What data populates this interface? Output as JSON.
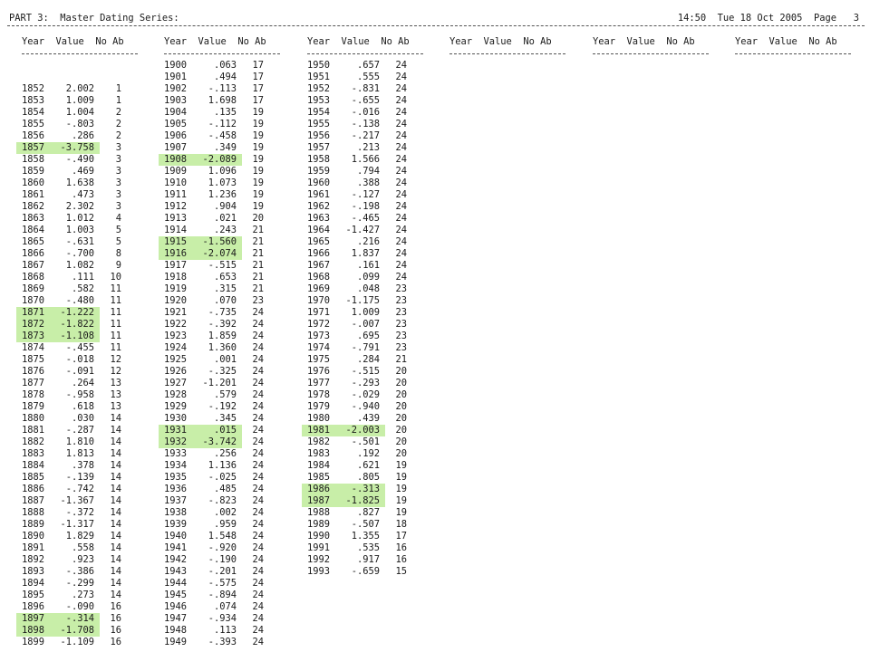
{
  "header": {
    "left": "PART 3:  Master Dating Series:",
    "right": "14:50  Tue 18 Oct 2005  Page   3"
  },
  "column_headers": {
    "year": "Year",
    "value": "Value",
    "noab": "No Ab"
  },
  "columns": [
    {
      "rows": [
        {
          "y": "",
          "v": "",
          "n": ""
        },
        {
          "y": "",
          "v": "",
          "n": ""
        },
        {
          "y": "1852",
          "v": "2.002",
          "n": "1"
        },
        {
          "y": "1853",
          "v": "1.009",
          "n": "1"
        },
        {
          "y": "1854",
          "v": "1.004",
          "n": "2"
        },
        {
          "y": "1855",
          "v": "-.803",
          "n": "2"
        },
        {
          "y": "1856",
          "v": ".286",
          "n": "2"
        },
        {
          "y": "1857",
          "v": "-3.758",
          "n": "3",
          "hl": true
        },
        {
          "y": "1858",
          "v": "-.490",
          "n": "3"
        },
        {
          "y": "1859",
          "v": ".469",
          "n": "3"
        },
        {
          "y": "1860",
          "v": "1.638",
          "n": "3"
        },
        {
          "y": "1861",
          "v": ".473",
          "n": "3"
        },
        {
          "y": "1862",
          "v": "2.302",
          "n": "3"
        },
        {
          "y": "1863",
          "v": "1.012",
          "n": "4"
        },
        {
          "y": "1864",
          "v": "1.003",
          "n": "5"
        },
        {
          "y": "1865",
          "v": "-.631",
          "n": "5"
        },
        {
          "y": "1866",
          "v": "-.700",
          "n": "8"
        },
        {
          "y": "1867",
          "v": "1.082",
          "n": "9"
        },
        {
          "y": "1868",
          "v": ".111",
          "n": "10"
        },
        {
          "y": "1869",
          "v": ".582",
          "n": "11"
        },
        {
          "y": "1870",
          "v": "-.480",
          "n": "11"
        },
        {
          "y": "1871",
          "v": "-1.222",
          "n": "11",
          "hl": true
        },
        {
          "y": "1872",
          "v": "-1.822",
          "n": "11",
          "hl": true
        },
        {
          "y": "1873",
          "v": "-1.108",
          "n": "11",
          "hl": true
        },
        {
          "y": "1874",
          "v": "-.455",
          "n": "11"
        },
        {
          "y": "1875",
          "v": "-.018",
          "n": "12"
        },
        {
          "y": "1876",
          "v": "-.091",
          "n": "12"
        },
        {
          "y": "1877",
          "v": ".264",
          "n": "13"
        },
        {
          "y": "1878",
          "v": "-.958",
          "n": "13"
        },
        {
          "y": "1879",
          "v": ".618",
          "n": "13"
        },
        {
          "y": "1880",
          "v": ".030",
          "n": "14"
        },
        {
          "y": "1881",
          "v": "-.287",
          "n": "14"
        },
        {
          "y": "1882",
          "v": "1.810",
          "n": "14"
        },
        {
          "y": "1883",
          "v": "1.813",
          "n": "14"
        },
        {
          "y": "1884",
          "v": ".378",
          "n": "14"
        },
        {
          "y": "1885",
          "v": "-.139",
          "n": "14"
        },
        {
          "y": "1886",
          "v": "-.742",
          "n": "14"
        },
        {
          "y": "1887",
          "v": "-1.367",
          "n": "14"
        },
        {
          "y": "1888",
          "v": "-.372",
          "n": "14"
        },
        {
          "y": "1889",
          "v": "-1.317",
          "n": "14"
        },
        {
          "y": "1890",
          "v": "1.829",
          "n": "14"
        },
        {
          "y": "1891",
          "v": ".558",
          "n": "14"
        },
        {
          "y": "1892",
          "v": ".923",
          "n": "14"
        },
        {
          "y": "1893",
          "v": "-.386",
          "n": "14"
        },
        {
          "y": "1894",
          "v": "-.299",
          "n": "14"
        },
        {
          "y": "1895",
          "v": ".273",
          "n": "14"
        },
        {
          "y": "1896",
          "v": "-.090",
          "n": "16"
        },
        {
          "y": "1897",
          "v": "-.314",
          "n": "16",
          "hl": true
        },
        {
          "y": "1898",
          "v": "-1.708",
          "n": "16",
          "hl": true
        },
        {
          "y": "1899",
          "v": "-1.109",
          "n": "16"
        }
      ]
    },
    {
      "rows": [
        {
          "y": "1900",
          "v": ".063",
          "n": "17"
        },
        {
          "y": "1901",
          "v": ".494",
          "n": "17"
        },
        {
          "y": "1902",
          "v": "-.113",
          "n": "17"
        },
        {
          "y": "1903",
          "v": "1.698",
          "n": "17"
        },
        {
          "y": "1904",
          "v": ".135",
          "n": "19"
        },
        {
          "y": "1905",
          "v": "-.112",
          "n": "19"
        },
        {
          "y": "1906",
          "v": "-.458",
          "n": "19"
        },
        {
          "y": "1907",
          "v": ".349",
          "n": "19"
        },
        {
          "y": "1908",
          "v": "-2.089",
          "n": "19",
          "hl": true
        },
        {
          "y": "1909",
          "v": "1.096",
          "n": "19"
        },
        {
          "y": "1910",
          "v": "1.073",
          "n": "19"
        },
        {
          "y": "1911",
          "v": "1.236",
          "n": "19"
        },
        {
          "y": "1912",
          "v": ".904",
          "n": "19"
        },
        {
          "y": "1913",
          "v": ".021",
          "n": "20"
        },
        {
          "y": "1914",
          "v": ".243",
          "n": "21"
        },
        {
          "y": "1915",
          "v": "-1.560",
          "n": "21",
          "hl": true
        },
        {
          "y": "1916",
          "v": "-2.074",
          "n": "21",
          "hl": true
        },
        {
          "y": "1917",
          "v": "-.515",
          "n": "21"
        },
        {
          "y": "1918",
          "v": ".653",
          "n": "21"
        },
        {
          "y": "1919",
          "v": ".315",
          "n": "21"
        },
        {
          "y": "1920",
          "v": ".070",
          "n": "23"
        },
        {
          "y": "1921",
          "v": "-.735",
          "n": "24"
        },
        {
          "y": "1922",
          "v": "-.392",
          "n": "24"
        },
        {
          "y": "1923",
          "v": "1.859",
          "n": "24"
        },
        {
          "y": "1924",
          "v": "1.360",
          "n": "24"
        },
        {
          "y": "1925",
          "v": ".001",
          "n": "24"
        },
        {
          "y": "1926",
          "v": "-.325",
          "n": "24"
        },
        {
          "y": "1927",
          "v": "-1.201",
          "n": "24"
        },
        {
          "y": "1928",
          "v": ".579",
          "n": "24"
        },
        {
          "y": "1929",
          "v": "-.192",
          "n": "24"
        },
        {
          "y": "1930",
          "v": ".345",
          "n": "24"
        },
        {
          "y": "1931",
          "v": ".015",
          "n": "24",
          "hl": true
        },
        {
          "y": "1932",
          "v": "-3.742",
          "n": "24",
          "hl": true
        },
        {
          "y": "1933",
          "v": ".256",
          "n": "24"
        },
        {
          "y": "1934",
          "v": "1.136",
          "n": "24"
        },
        {
          "y": "1935",
          "v": "-.025",
          "n": "24"
        },
        {
          "y": "1936",
          "v": ".485",
          "n": "24"
        },
        {
          "y": "1937",
          "v": "-.823",
          "n": "24"
        },
        {
          "y": "1938",
          "v": ".002",
          "n": "24"
        },
        {
          "y": "1939",
          "v": ".959",
          "n": "24"
        },
        {
          "y": "1940",
          "v": "1.548",
          "n": "24"
        },
        {
          "y": "1941",
          "v": "-.920",
          "n": "24"
        },
        {
          "y": "1942",
          "v": "-.190",
          "n": "24"
        },
        {
          "y": "1943",
          "v": "-.201",
          "n": "24"
        },
        {
          "y": "1944",
          "v": "-.575",
          "n": "24"
        },
        {
          "y": "1945",
          "v": "-.894",
          "n": "24"
        },
        {
          "y": "1946",
          "v": ".074",
          "n": "24"
        },
        {
          "y": "1947",
          "v": "-.934",
          "n": "24"
        },
        {
          "y": "1948",
          "v": ".113",
          "n": "24"
        },
        {
          "y": "1949",
          "v": "-.393",
          "n": "24"
        }
      ]
    },
    {
      "rows": [
        {
          "y": "1950",
          "v": ".657",
          "n": "24"
        },
        {
          "y": "1951",
          "v": ".555",
          "n": "24"
        },
        {
          "y": "1952",
          "v": "-.831",
          "n": "24"
        },
        {
          "y": "1953",
          "v": "-.655",
          "n": "24"
        },
        {
          "y": "1954",
          "v": "-.016",
          "n": "24"
        },
        {
          "y": "1955",
          "v": "-.138",
          "n": "24"
        },
        {
          "y": "1956",
          "v": "-.217",
          "n": "24"
        },
        {
          "y": "1957",
          "v": ".213",
          "n": "24"
        },
        {
          "y": "1958",
          "v": "1.566",
          "n": "24"
        },
        {
          "y": "1959",
          "v": ".794",
          "n": "24"
        },
        {
          "y": "1960",
          "v": ".388",
          "n": "24"
        },
        {
          "y": "1961",
          "v": "-.127",
          "n": "24"
        },
        {
          "y": "1962",
          "v": "-.198",
          "n": "24"
        },
        {
          "y": "1963",
          "v": "-.465",
          "n": "24"
        },
        {
          "y": "1964",
          "v": "-1.427",
          "n": "24"
        },
        {
          "y": "1965",
          "v": ".216",
          "n": "24"
        },
        {
          "y": "1966",
          "v": "1.837",
          "n": "24"
        },
        {
          "y": "1967",
          "v": ".161",
          "n": "24"
        },
        {
          "y": "1968",
          "v": ".099",
          "n": "24"
        },
        {
          "y": "1969",
          "v": ".048",
          "n": "23"
        },
        {
          "y": "1970",
          "v": "-1.175",
          "n": "23"
        },
        {
          "y": "1971",
          "v": "1.009",
          "n": "23"
        },
        {
          "y": "1972",
          "v": "-.007",
          "n": "23"
        },
        {
          "y": "1973",
          "v": ".695",
          "n": "23"
        },
        {
          "y": "1974",
          "v": "-.791",
          "n": "23"
        },
        {
          "y": "1975",
          "v": ".284",
          "n": "21"
        },
        {
          "y": "1976",
          "v": "-.515",
          "n": "20"
        },
        {
          "y": "1977",
          "v": "-.293",
          "n": "20"
        },
        {
          "y": "1978",
          "v": "-.029",
          "n": "20"
        },
        {
          "y": "1979",
          "v": "-.940",
          "n": "20"
        },
        {
          "y": "1980",
          "v": ".439",
          "n": "20"
        },
        {
          "y": "1981",
          "v": "-2.003",
          "n": "20",
          "hl": true
        },
        {
          "y": "1982",
          "v": "-.501",
          "n": "20"
        },
        {
          "y": "1983",
          "v": ".192",
          "n": "20"
        },
        {
          "y": "1984",
          "v": ".621",
          "n": "19"
        },
        {
          "y": "1985",
          "v": ".805",
          "n": "19"
        },
        {
          "y": "1986",
          "v": "-.313",
          "n": "19",
          "hl": true
        },
        {
          "y": "1987",
          "v": "-1.825",
          "n": "19",
          "hl": true
        },
        {
          "y": "1988",
          "v": ".827",
          "n": "19"
        },
        {
          "y": "1989",
          "v": "-.507",
          "n": "18"
        },
        {
          "y": "1990",
          "v": "1.355",
          "n": "17"
        },
        {
          "y": "1991",
          "v": ".535",
          "n": "16"
        },
        {
          "y": "1992",
          "v": ".917",
          "n": "16"
        },
        {
          "y": "1993",
          "v": "-.659",
          "n": "15"
        }
      ]
    },
    {
      "rows": []
    },
    {
      "rows": []
    },
    {
      "rows": []
    }
  ]
}
